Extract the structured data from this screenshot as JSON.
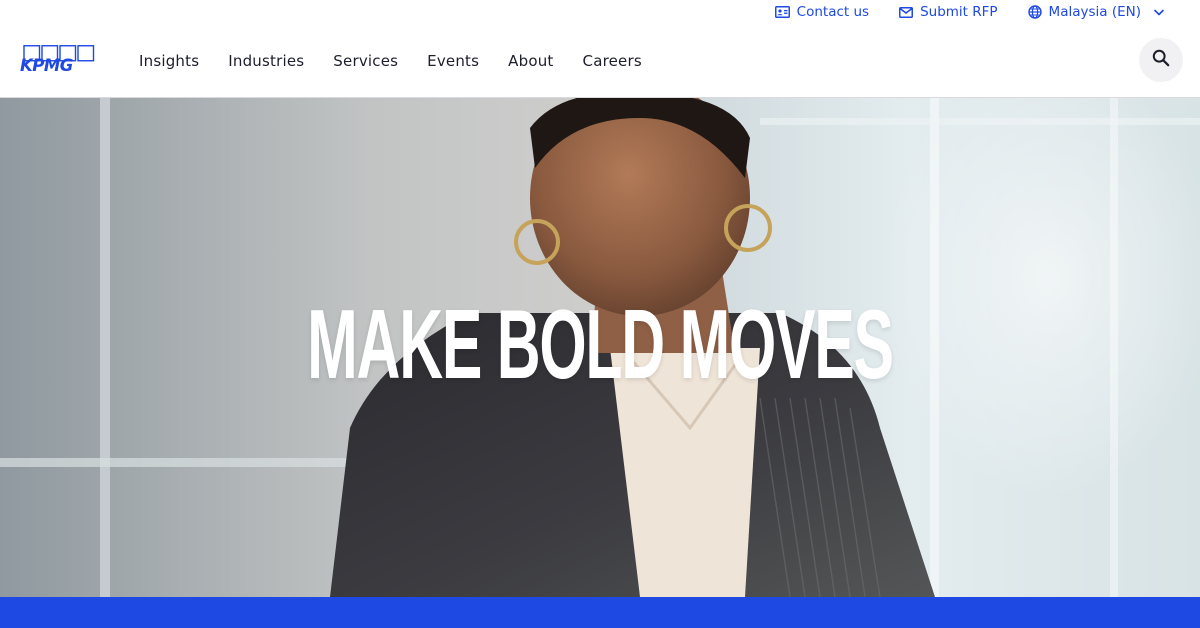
{
  "utility": {
    "contact_label": "Contact us",
    "rfp_label": "Submit RFP",
    "region_label": "Malaysia (EN)"
  },
  "header": {
    "logo_text": "KPMG",
    "nav": [
      "Insights",
      "Industries",
      "Services",
      "Events",
      "About",
      "Careers"
    ]
  },
  "hero": {
    "headline": "MAKE BOLD MOVES"
  },
  "icons": {
    "contact": "contact-card-icon",
    "rfp": "mail-icon",
    "region": "globe-icon",
    "region_toggle": "chevron-down-icon",
    "search": "search-icon"
  },
  "colors": {
    "brand_blue": "#1e49e2",
    "text_dark": "#1e1e2d",
    "search_bg": "#f1f1f3",
    "hero_text": "#ffffff"
  }
}
